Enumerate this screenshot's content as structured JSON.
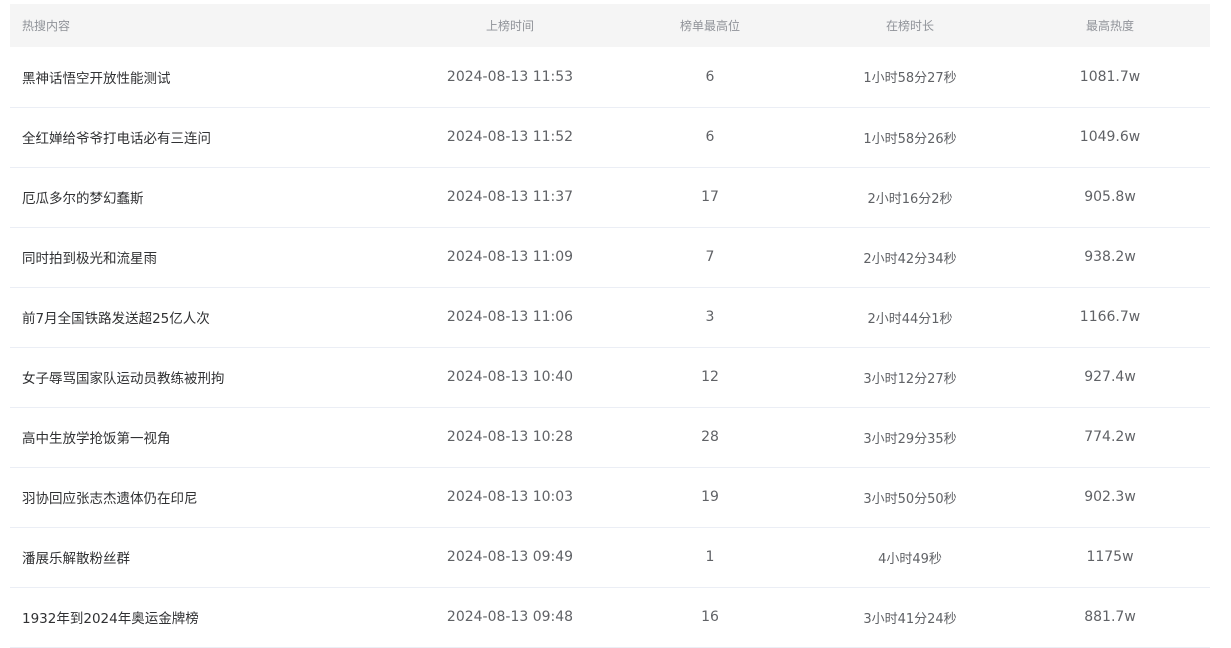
{
  "table": {
    "headers": {
      "title": "热搜内容",
      "time": "上榜时间",
      "rank": "榜单最高位",
      "duration": "在榜时长",
      "heat": "最高热度"
    },
    "rows": [
      {
        "title": "黑神话悟空开放性能测试",
        "time": "2024-08-13 11:53",
        "rank": "6",
        "duration": "1小时58分27秒",
        "heat": "1081.7w"
      },
      {
        "title": "全红婵给爷爷打电话必有三连问",
        "time": "2024-08-13 11:52",
        "rank": "6",
        "duration": "1小时58分26秒",
        "heat": "1049.6w"
      },
      {
        "title": "厄瓜多尔的梦幻蠢斯",
        "time": "2024-08-13 11:37",
        "rank": "17",
        "duration": "2小时16分2秒",
        "heat": "905.8w"
      },
      {
        "title": "同时拍到极光和流星雨",
        "time": "2024-08-13 11:09",
        "rank": "7",
        "duration": "2小时42分34秒",
        "heat": "938.2w"
      },
      {
        "title": "前7月全国铁路发送超25亿人次",
        "time": "2024-08-13 11:06",
        "rank": "3",
        "duration": "2小时44分1秒",
        "heat": "1166.7w"
      },
      {
        "title": "女子辱骂国家队运动员教练被刑拘",
        "time": "2024-08-13 10:40",
        "rank": "12",
        "duration": "3小时12分27秒",
        "heat": "927.4w"
      },
      {
        "title": "高中生放学抢饭第一视角",
        "time": "2024-08-13 10:28",
        "rank": "28",
        "duration": "3小时29分35秒",
        "heat": "774.2w"
      },
      {
        "title": "羽协回应张志杰遗体仍在印尼",
        "time": "2024-08-13 10:03",
        "rank": "19",
        "duration": "3小时50分50秒",
        "heat": "902.3w"
      },
      {
        "title": "潘展乐解散粉丝群",
        "time": "2024-08-13 09:49",
        "rank": "1",
        "duration": "4小时49秒",
        "heat": "1175w"
      },
      {
        "title": "1932年到2024年奥运金牌榜",
        "time": "2024-08-13 09:48",
        "rank": "16",
        "duration": "3小时41分24秒",
        "heat": "881.7w"
      }
    ]
  }
}
